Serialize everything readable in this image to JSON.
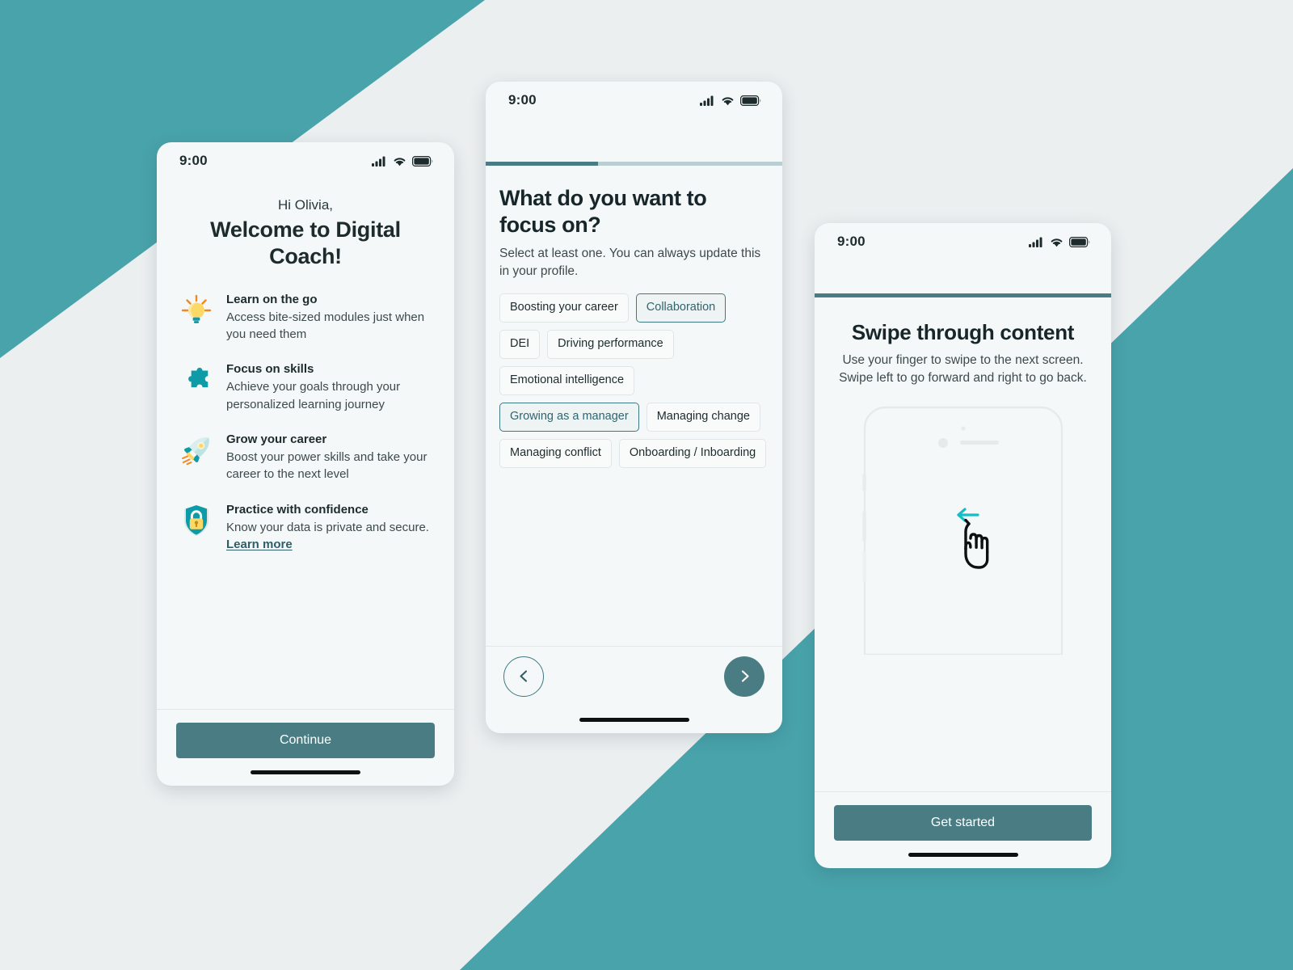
{
  "theme": {
    "teal_background": "#49a3ab",
    "light_background": "#eceff0",
    "phone_surface": "#f5f8f8",
    "accent_button": "#4a7c84",
    "accent_border": "#3f7883",
    "heading_color": "#17262a",
    "body_color": "#3d4a4c",
    "progress_track": "#b9cfd2",
    "link_color": "#2e5f68",
    "swipe_arrow_color": "#15bdc4"
  },
  "phone_one": {
    "status": {
      "time": "9:00",
      "cellular_icon": "signal-bars-icon",
      "wifi_icon": "wifi-icon",
      "battery_icon": "battery-full-icon"
    },
    "greeting": "Hi Olivia,",
    "title": "Welcome to Digital Coach!",
    "features": [
      {
        "icon": "lightbulb-icon",
        "title": "Learn on the go",
        "description": "Access bite-sized modules just when you need them"
      },
      {
        "icon": "puzzle-piece-icon",
        "title": "Focus on skills",
        "description": "Achieve your goals through your personalized learning journey"
      },
      {
        "icon": "rocket-icon",
        "title": "Grow your career",
        "description": "Boost your power skills and take your career to the next level"
      },
      {
        "icon": "shield-lock-icon",
        "title": "Practice with confidence",
        "description_before_link": "Know your data is private and secure. ",
        "link_text": "Learn more"
      }
    ],
    "continue_label": "Continue"
  },
  "phone_two": {
    "status": {
      "time": "9:00",
      "cellular_icon": "signal-bars-icon",
      "wifi_icon": "wifi-icon",
      "battery_icon": "battery-full-icon"
    },
    "progress_percent": 38,
    "title": "What do you want to focus on?",
    "subtitle": "Select at least one. You can always update this in your profile.",
    "chips": [
      {
        "label": "Boosting your career",
        "selected": false
      },
      {
        "label": "Collaboration",
        "selected": true
      },
      {
        "label": "DEI",
        "selected": false
      },
      {
        "label": "Driving performance",
        "selected": false
      },
      {
        "label": "Emotional intelligence",
        "selected": false
      },
      {
        "label": "Growing as a manager",
        "selected": true
      },
      {
        "label": "Managing change",
        "selected": false
      },
      {
        "label": "Managing conflict",
        "selected": false
      },
      {
        "label": "Onboarding / Inboarding",
        "selected": false
      }
    ],
    "back_icon": "chevron-left-icon",
    "next_icon": "chevron-right-icon"
  },
  "phone_three": {
    "status": {
      "time": "9:00",
      "cellular_icon": "signal-bars-icon",
      "wifi_icon": "wifi-icon",
      "battery_icon": "battery-full-icon"
    },
    "progress_percent": 100,
    "title": "Swipe through content",
    "subtitle": "Use your finger to swipe to the next screen. Swipe left to go forward and right to go back.",
    "illustration": {
      "device_icon": "phone-outline-icon",
      "gesture_icon": "pointing-hand-icon",
      "direction_icon": "arrow-left-icon"
    },
    "get_started_label": "Get started"
  }
}
